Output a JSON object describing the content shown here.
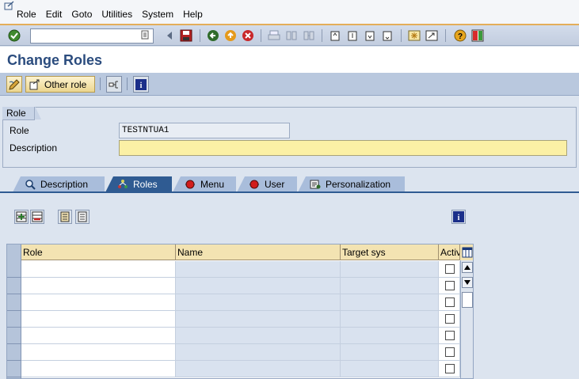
{
  "menu": {
    "items": [
      {
        "label": "Role"
      },
      {
        "label": "Edit"
      },
      {
        "label": "Goto"
      },
      {
        "label": "Utilities"
      },
      {
        "label": "System"
      },
      {
        "label": "Help"
      }
    ]
  },
  "toolbar": {
    "command_field": {
      "value": ""
    }
  },
  "title": "Change Roles",
  "app_toolbar": {
    "other_role_label": "Other role"
  },
  "role_group": {
    "title": "Role",
    "role_label": "Role",
    "role_value": "TESTNTUA1",
    "description_label": "Description",
    "description_value": ""
  },
  "tabs": [
    {
      "label": "Description",
      "active": false
    },
    {
      "label": "Roles",
      "active": true
    },
    {
      "label": "Menu",
      "active": false
    },
    {
      "label": "User",
      "active": false
    },
    {
      "label": "Personalization",
      "active": false
    }
  ],
  "table": {
    "columns": [
      "Role",
      "Name",
      "Target sys",
      "Activ"
    ],
    "rows": [
      {
        "role": "",
        "name": "",
        "target": "",
        "active": false
      },
      {
        "role": "",
        "name": "",
        "target": "",
        "active": false
      },
      {
        "role": "",
        "name": "",
        "target": "",
        "active": false
      },
      {
        "role": "",
        "name": "",
        "target": "",
        "active": false
      },
      {
        "role": "",
        "name": "",
        "target": "",
        "active": false
      },
      {
        "role": "",
        "name": "",
        "target": "",
        "active": false
      },
      {
        "role": "",
        "name": "",
        "target": "",
        "active": false
      }
    ]
  },
  "colors": {
    "title": "#2b4c7e",
    "active_tab": "#2f5b92",
    "required_field": "#fbf0a5",
    "table_header": "#f3e3b2"
  }
}
